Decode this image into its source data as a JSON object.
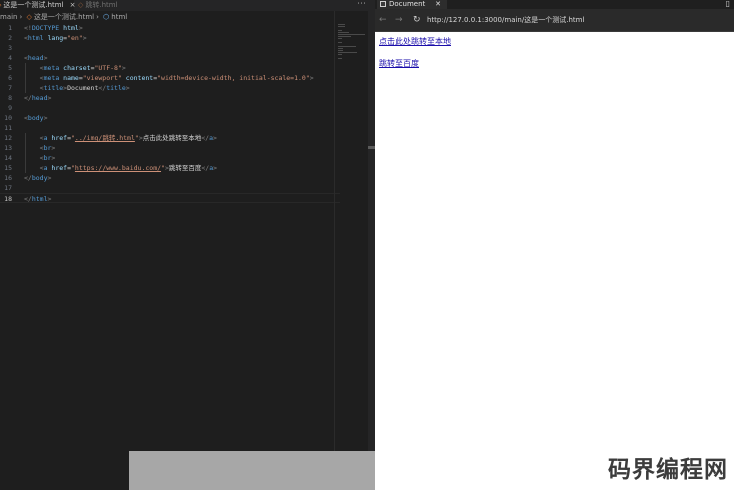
{
  "editor": {
    "tabs": [
      {
        "label": "这是一个测试.html",
        "active": true
      },
      {
        "label": "跳转.html",
        "active": false
      }
    ],
    "breadcrumb": {
      "folder": "main",
      "file": "这是一个测试.html",
      "element": "html"
    },
    "code_lines": [
      {
        "n": "1",
        "html": "<span class=\"gr\">&lt;!</span><span class=\"tg\">DOCTYPE</span> <span class=\"an\">html</span><span class=\"gr\">&gt;</span>"
      },
      {
        "n": "2",
        "html": "<span class=\"gr\">&lt;</span><span class=\"tg\">html</span> <span class=\"an\">lang</span><span class=\"tx\">=</span><span class=\"av\">\"en\"</span><span class=\"gr\">&gt;</span>"
      },
      {
        "n": "3",
        "html": ""
      },
      {
        "n": "4",
        "html": "<span class=\"gr\">&lt;</span><span class=\"tg\">head</span><span class=\"gr\">&gt;</span>"
      },
      {
        "n": "5",
        "html": "    <span class=\"gr\">&lt;</span><span class=\"tg\">meta</span> <span class=\"an\">charset</span><span class=\"tx\">=</span><span class=\"av\">\"UTF-8\"</span><span class=\"gr\">&gt;</span>"
      },
      {
        "n": "6",
        "html": "    <span class=\"gr\">&lt;</span><span class=\"tg\">meta</span> <span class=\"an\">name</span><span class=\"tx\">=</span><span class=\"av\">\"viewport\"</span> <span class=\"an\">content</span><span class=\"tx\">=</span><span class=\"av\">\"width=device-width, initial-scale=1.0\"</span><span class=\"gr\">&gt;</span>"
      },
      {
        "n": "7",
        "html": "    <span class=\"gr\">&lt;</span><span class=\"tg\">title</span><span class=\"gr\">&gt;</span><span class=\"tx\">Document</span><span class=\"gr\">&lt;/</span><span class=\"tg\">title</span><span class=\"gr\">&gt;</span>"
      },
      {
        "n": "8",
        "html": "<span class=\"gr\">&lt;/</span><span class=\"tg\">head</span><span class=\"gr\">&gt;</span>"
      },
      {
        "n": "9",
        "html": ""
      },
      {
        "n": "10",
        "html": "<span class=\"gr\">&lt;</span><span class=\"tg\">body</span><span class=\"gr\">&gt;</span>"
      },
      {
        "n": "11",
        "html": ""
      },
      {
        "n": "12",
        "html": "    <span class=\"gr\">&lt;</span><span class=\"tg\">a</span> <span class=\"an\">href</span><span class=\"tx\">=</span><span class=\"av\">\"<span class=\"ul\">../img/跳转.html</span>\"</span><span class=\"gr\">&gt;</span><span class=\"tx\">点击此处跳转至本地</span><span class=\"gr\">&lt;/</span><span class=\"tg\">a</span><span class=\"gr\">&gt;</span>"
      },
      {
        "n": "13",
        "html": "    <span class=\"gr\">&lt;</span><span class=\"tg\">br</span><span class=\"gr\">&gt;</span>"
      },
      {
        "n": "14",
        "html": "    <span class=\"gr\">&lt;</span><span class=\"tg\">br</span><span class=\"gr\">&gt;</span>"
      },
      {
        "n": "15",
        "html": "    <span class=\"gr\">&lt;</span><span class=\"tg\">a</span> <span class=\"an\">href</span><span class=\"tx\">=</span><span class=\"av\">\"<span class=\"ul\">https://www.baidu.com/</span>\"</span><span class=\"gr\">&gt;</span><span class=\"tx\">跳转至百度</span><span class=\"gr\">&lt;/</span><span class=\"tg\">a</span><span class=\"gr\">&gt;</span>"
      },
      {
        "n": "16",
        "html": "<span class=\"gr\">&lt;/</span><span class=\"tg\">body</span><span class=\"gr\">&gt;</span>"
      },
      {
        "n": "17",
        "html": ""
      },
      {
        "n": "18",
        "html": "<span class=\"gr\">&lt;/</span><span class=\"tg\">html</span><span class=\"gr\">&gt;</span>"
      }
    ],
    "current_line": "18"
  },
  "browser": {
    "tab_title": "Document",
    "url": "http://127.0.0.1:3000/main/这是一个测试.html",
    "links": [
      {
        "text": "点击此处跳转至本地"
      },
      {
        "text": "跳转至百度"
      }
    ]
  },
  "watermark": "码界编程网",
  "colors": {
    "editor_bg": "#1e1e1e",
    "tag": "#569cd6",
    "attr_name": "#9cdcfe",
    "attr_value": "#ce9178",
    "link": "#1a0dab"
  }
}
